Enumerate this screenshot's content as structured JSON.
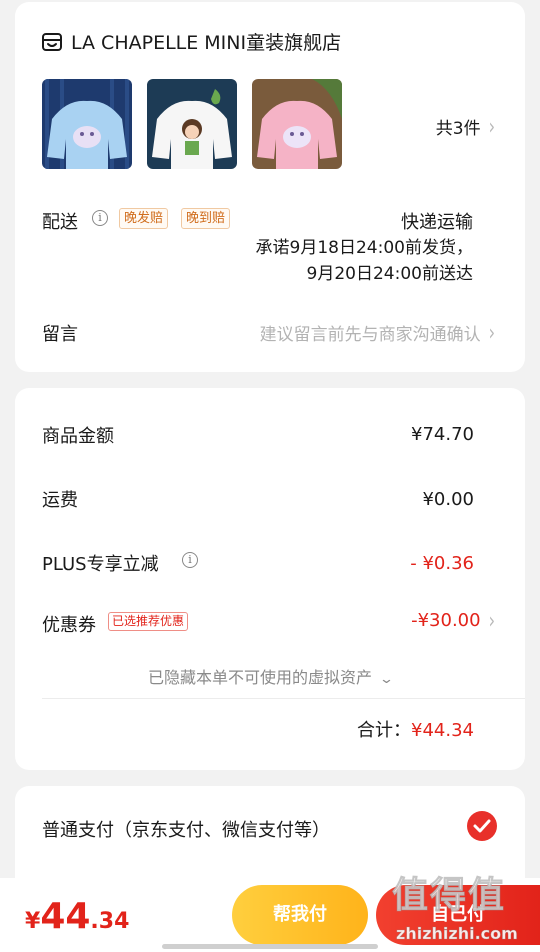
{
  "store": {
    "name": "LA CHAPELLE MINI童装旗舰店",
    "item_count": "共3件",
    "products": [
      {
        "bg": "#1e3a6e",
        "shirt": "#a9d2f2"
      },
      {
        "bg": "#1d3b55",
        "shirt": "#f6f6f6"
      },
      {
        "bg": "#7a5b3c",
        "shirt": "#f5b3c6"
      }
    ]
  },
  "shipping": {
    "label": "配送",
    "tags": [
      "晚发赔",
      "晚到赔"
    ],
    "method": "快递运输",
    "promise_line1": "承诺9月18日24:00前发货，",
    "promise_line2": "9月20日24:00前送达"
  },
  "note": {
    "label": "留言",
    "placeholder": "建议留言前先与商家沟通确认"
  },
  "amounts": {
    "goods_label": "商品金额",
    "goods_value": "¥74.70",
    "freight_label": "运费",
    "freight_value": "¥0.00",
    "plus_label": "PLUS专享立减",
    "plus_value": "- ¥0.36",
    "coupon_label": "优惠券",
    "coupon_tag": "已选推荐优惠",
    "coupon_value": "-¥30.00",
    "hidden_assets": "已隐藏本单不可使用的虚拟资产",
    "total_label": "合计：",
    "total_value": "¥44.34"
  },
  "payment": {
    "method": "普通支付（京东支付、微信支付等）"
  },
  "bottom": {
    "price_currency": "¥",
    "price_int": "44",
    "price_dec": ".34",
    "help_pay": "帮我付",
    "self_pay": "自己付"
  },
  "watermark": {
    "big": "值得值",
    "small": "zhizhizhi.com"
  },
  "colors": {
    "accent_red": "#e2231a",
    "help_button": "#ffc12b"
  }
}
